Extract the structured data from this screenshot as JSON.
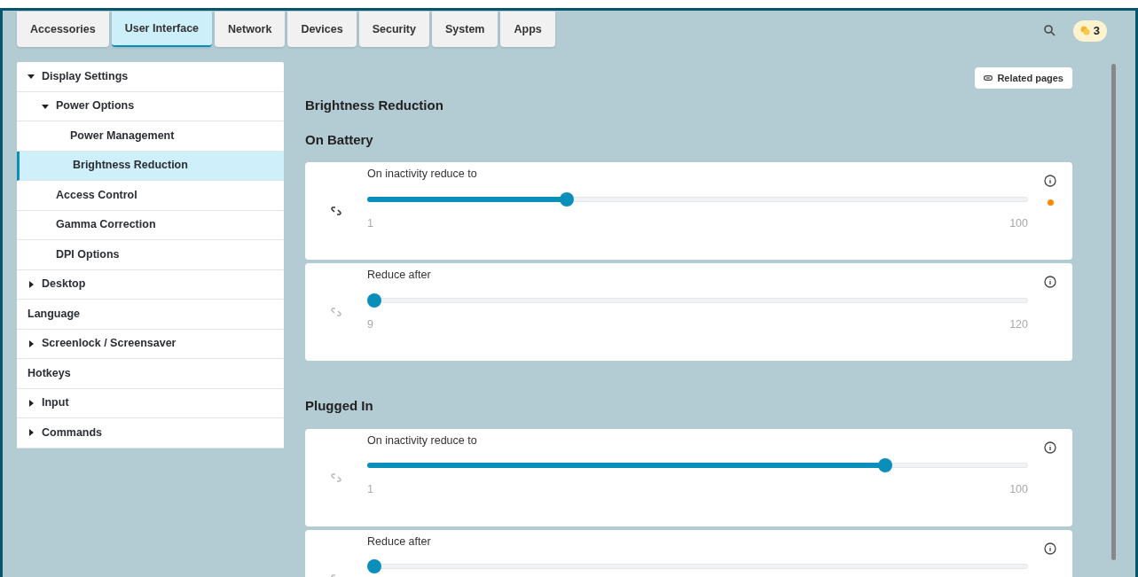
{
  "tabs": [
    {
      "label": "Accessories",
      "selected": false
    },
    {
      "label": "User Interface",
      "selected": true
    },
    {
      "label": "Network",
      "selected": false
    },
    {
      "label": "Devices",
      "selected": false
    },
    {
      "label": "Security",
      "selected": false
    },
    {
      "label": "System",
      "selected": false
    },
    {
      "label": "Apps",
      "selected": false
    }
  ],
  "badge": {
    "count": "3"
  },
  "sidebar": {
    "items": [
      {
        "label": "Display Settings",
        "expanded": true,
        "selected": false,
        "children": [
          {
            "label": "Power Options",
            "expanded": true,
            "selected": false,
            "children": [
              {
                "label": "Power Management",
                "selected": false
              },
              {
                "label": "Brightness Reduction",
                "selected": true
              }
            ]
          },
          {
            "label": "Access Control",
            "selected": false
          },
          {
            "label": "Gamma Correction",
            "selected": false
          },
          {
            "label": "DPI Options",
            "selected": false
          }
        ]
      },
      {
        "label": "Desktop",
        "expanded": false,
        "selected": false
      },
      {
        "label": "Language",
        "selected": false
      },
      {
        "label": "Screenlock / Screensaver",
        "expanded": false,
        "selected": false
      },
      {
        "label": "Hotkeys",
        "selected": false
      },
      {
        "label": "Input",
        "expanded": false,
        "selected": false
      },
      {
        "label": "Commands",
        "expanded": false,
        "selected": false
      }
    ]
  },
  "related_button": "Related pages",
  "page_title": "Brightness Reduction",
  "sections": [
    {
      "title": "On Battery",
      "settings": [
        {
          "label": "On inactivity reduce to",
          "level": 0.297,
          "min": "1",
          "max": "100",
          "modified": true
        },
        {
          "label": "Reduce after",
          "level": 0,
          "min": "9",
          "max": "120",
          "modified": false
        }
      ]
    },
    {
      "title": "Plugged In",
      "settings": [
        {
          "label": "On inactivity reduce to",
          "level": 0.79,
          "min": "1",
          "max": "100",
          "modified": false
        },
        {
          "label": "Reduce after",
          "level": 0,
          "modified": false
        }
      ]
    }
  ]
}
